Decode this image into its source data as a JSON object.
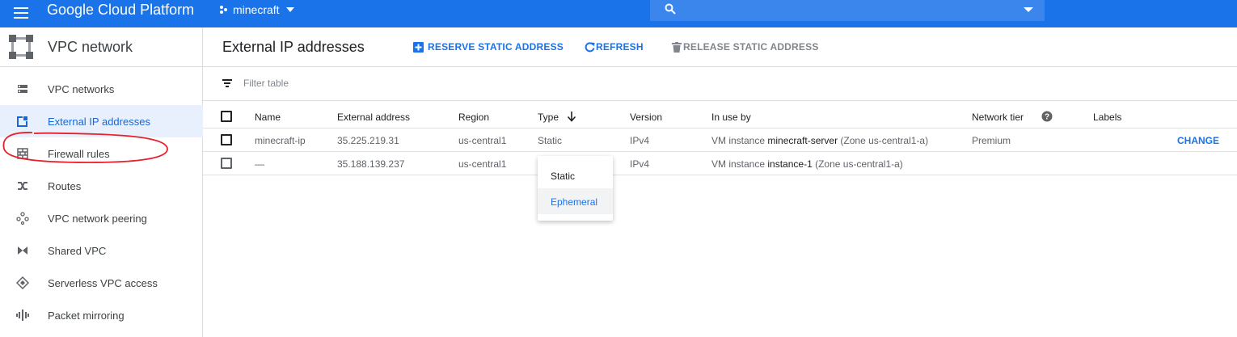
{
  "topbar": {
    "brand": "Google Cloud Platform",
    "project": "minecraft",
    "search_placeholder": ""
  },
  "sidebar": {
    "title": "VPC network",
    "items": [
      {
        "label": "VPC networks",
        "icon": "vpc-networks-icon"
      },
      {
        "label": "External IP addresses",
        "icon": "external-ip-icon",
        "active": true
      },
      {
        "label": "Firewall rules",
        "icon": "firewall-icon"
      },
      {
        "label": "Routes",
        "icon": "routes-icon"
      },
      {
        "label": "VPC network peering",
        "icon": "peering-icon"
      },
      {
        "label": "Shared VPC",
        "icon": "shared-vpc-icon"
      },
      {
        "label": "Serverless VPC access",
        "icon": "serverless-icon"
      },
      {
        "label": "Packet mirroring",
        "icon": "packet-mirroring-icon"
      }
    ]
  },
  "header": {
    "title": "External IP addresses",
    "reserve": "RESERVE STATIC ADDRESS",
    "refresh": "REFRESH",
    "release": "RELEASE STATIC ADDRESS"
  },
  "filter": {
    "placeholder": "Filter table"
  },
  "table": {
    "columns": {
      "name": "Name",
      "address": "External address",
      "region": "Region",
      "type": "Type",
      "version": "Version",
      "inuse": "In use by",
      "tier": "Network tier",
      "labels": "Labels"
    },
    "rows": [
      {
        "name": "minecraft-ip",
        "address": "35.225.219.31",
        "region": "us-central1",
        "type": "Static",
        "version": "IPv4",
        "inuse_prefix": "VM instance ",
        "inuse_vm": "minecraft-server",
        "inuse_zone": " (Zone us-central1-a)",
        "tier": "Premium",
        "action": "CHANGE"
      },
      {
        "name": "—",
        "address": "35.188.139.237",
        "region": "us-central1",
        "type": "",
        "version": "IPv4",
        "inuse_prefix": "VM instance ",
        "inuse_vm": "instance-1",
        "inuse_zone": " (Zone us-central1-a)",
        "tier": "",
        "action": ""
      }
    ]
  },
  "type_dropdown": {
    "options": [
      "Static",
      "Ephemeral"
    ],
    "selected": "Ephemeral"
  },
  "colors": {
    "brand_blue": "#1a73e8",
    "annotation_red": "#e8202b",
    "active_bg": "#e8f0fe"
  }
}
